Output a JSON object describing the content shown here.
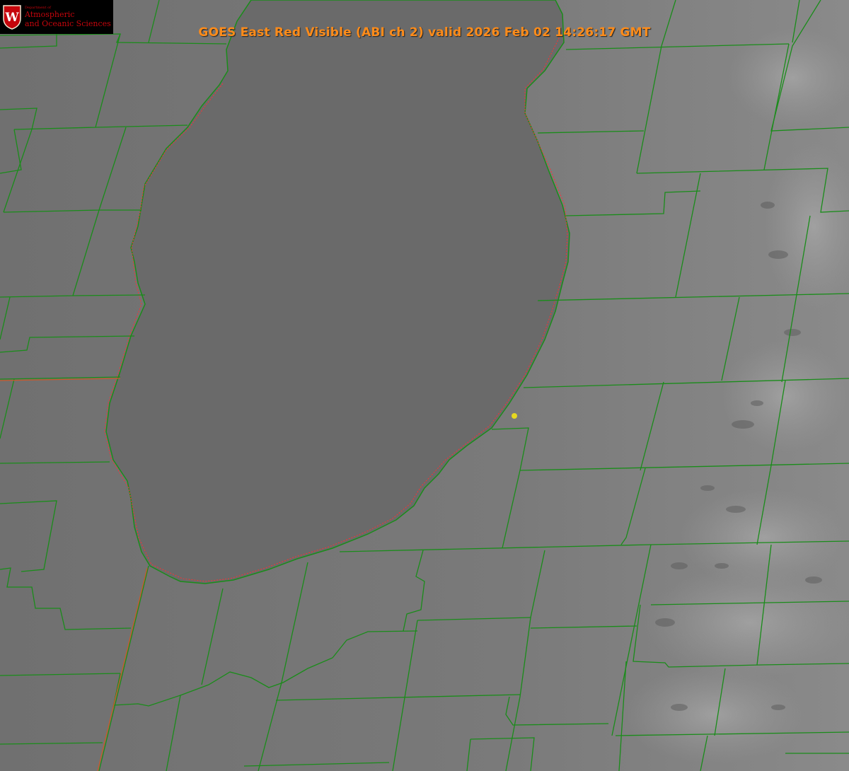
{
  "title": "GOES East Red Visible (ABI ch 2) valid 2026 Feb 02 14:26:17 GMT",
  "logo": {
    "department": "Department of",
    "line1": "Atmospheric",
    "line2": "and Oceanic Sciences",
    "crest_letter": "W"
  },
  "colors": {
    "title": "#ff8c1a",
    "land": "#7a7a7a",
    "lake": "#6a6a6a",
    "county_border": "#1a8c1a",
    "shoreline": "#ff3030",
    "marker": "#e6d820",
    "logo_text": "#c5050c"
  },
  "map": {
    "feature": "lake",
    "marker": "location-dot"
  }
}
